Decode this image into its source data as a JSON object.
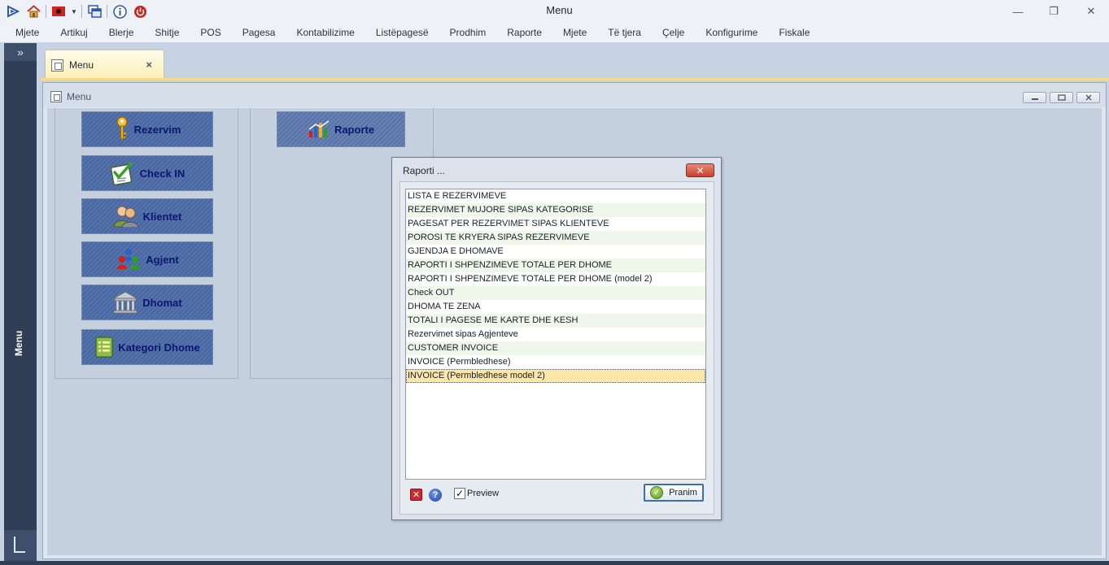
{
  "app": {
    "title": "Menu"
  },
  "window_controls": {
    "minimize": "—",
    "restore": "❐",
    "close": "✕"
  },
  "menubar": {
    "items": [
      "Mjete",
      "Artikuj",
      "Blerje",
      "Shitje",
      "POS",
      "Pagesa",
      "Kontabilizime",
      "Listëpagesë",
      "Prodhim",
      "Raporte",
      "Mjete",
      "Të tjera",
      "Çelje",
      "Konfigurime",
      "Fiskale"
    ]
  },
  "leftpane": {
    "expand_glyph": "»",
    "label": "Menu"
  },
  "doc_tab": {
    "label": "Menu",
    "close": "×"
  },
  "mdi": {
    "title": "Menu"
  },
  "tiles": {
    "rezervim": "Rezervim",
    "checkin": "Check IN",
    "klientet": "Klientet",
    "agjent": "Agjent",
    "dhomat": "Dhomat",
    "kategori": "Kategori Dhome",
    "raporte": "Raporte"
  },
  "dialog": {
    "title": "Raporti ...",
    "close": "✕",
    "reports": [
      "LISTA E REZERVIMEVE",
      "REZERVIMET MUJORE SIPAS KATEGORISE",
      "PAGESAT PER REZERVIMET SIPAS KLIENTEVE",
      "POROSI TE KRYERA SIPAS REZERVIMEVE",
      "GJENDJA E DHOMAVE",
      "RAPORTI I SHPENZIMEVE TOTALE PER DHOME",
      "RAPORTI I SHPENZIMEVE TOTALE PER DHOME (model 2)",
      "Check OUT",
      "DHOMA TE ZENA",
      "TOTALI I PAGESE ME KARTE DHE KESH",
      "Rezervimet sipas Agjenteve",
      "CUSTOMER  INVOICE",
      "INVOICE (Permbledhese)",
      "INVOICE (Permbledhese model 2)"
    ],
    "selected_index": 13,
    "preview_label": "Preview",
    "preview_checked": true,
    "ok_label": "Pranim"
  },
  "icons": {
    "qat": [
      "play-icon",
      "home-icon",
      "flag-icon",
      "windows-icon",
      "info-icon",
      "power-icon"
    ],
    "tiles": [
      "key-icon",
      "checklist-icon",
      "clients-icon",
      "agents-icon",
      "bank-icon",
      "notes-icon",
      "report-icon"
    ]
  },
  "colors": {
    "tile_text": "#0a1670",
    "tile_bg": "#4a669e",
    "selected_row": "#fde7a6",
    "alt_row": "#eef7ea",
    "left_pane": "#2f3e55"
  }
}
